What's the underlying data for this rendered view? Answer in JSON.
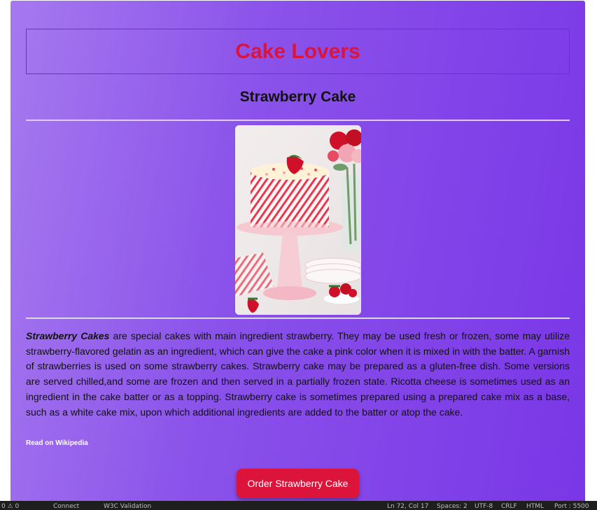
{
  "header": {
    "title": "Cake Lovers"
  },
  "cake": {
    "name": "Strawberry Cake",
    "description_lead": "Strawberry Cakes",
    "description_body": " are special cakes with main ingredient strawberry. They may be used fresh or frozen, some may utilize strawberry-flavored gelatin as an ingredient, which can give the cake a pink color when it is mixed in with the batter. A garnish of strawberries is used on some strawberry cakes. Strawberry cake may be prepared as a gluten-free dish. Some versions are served chilled,and some are frozen and then served in a partially frozen state. Ricotta cheese is sometimes used as an ingredient in the cake batter or as a topping. Strawberry cake is sometimes prepared using a prepared cake mix as a base, such as a white cake mix, upon which additional ingredients are added to the batter or atop the cake.",
    "wiki_link": "Read on Wikipedia",
    "order_button": "Order Strawberry Cake"
  },
  "statusbar": {
    "left": [
      "0 ⚠ 0",
      "Connect",
      "W3C Validation"
    ],
    "right": [
      "Ln 72, Col 17",
      "Spaces: 2",
      "UTF-8",
      "CRLF",
      "HTML",
      "Port : 5500"
    ]
  },
  "colors": {
    "accent": "#dc143c",
    "gradient_start": "#a679ef",
    "gradient_end": "#7a36e7"
  }
}
